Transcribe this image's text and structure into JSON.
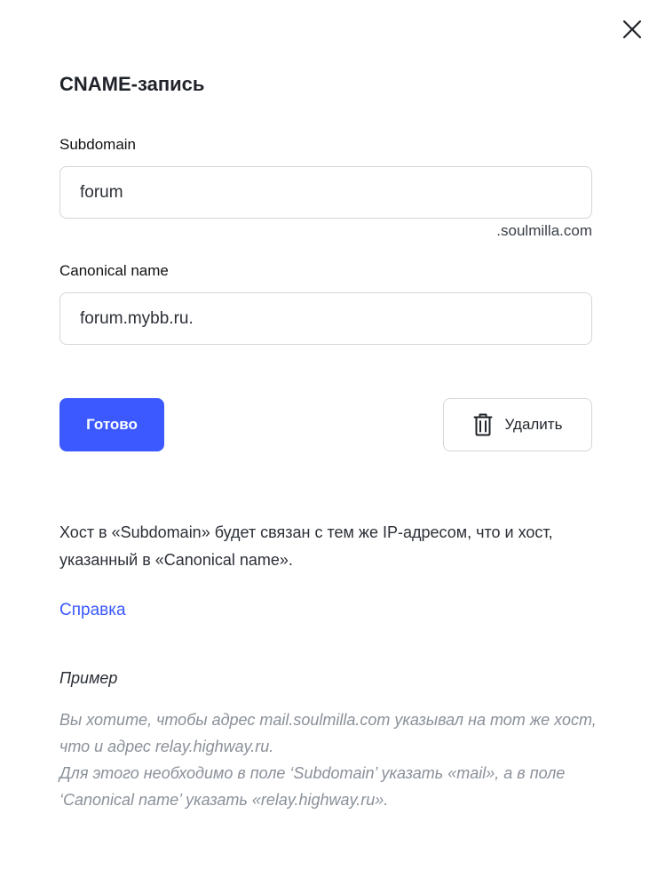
{
  "dialog": {
    "title": "CNAME-запись",
    "close_icon": "close-icon"
  },
  "form": {
    "subdomain": {
      "label": "Subdomain",
      "value": "forum",
      "suffix": ".soulmilla.com"
    },
    "canonical": {
      "label": "Canonical name",
      "value": "forum.mybb.ru."
    }
  },
  "actions": {
    "done_label": "Готово",
    "delete_label": "Удалить",
    "delete_icon": "trash-icon"
  },
  "info": {
    "description": "Хост в «Subdomain» будет связан с тем же IP-адресом, что и хост, указанный в «Canonical name».",
    "help_link": "Справка"
  },
  "example": {
    "title": "Пример",
    "line1": "Вы хотите, чтобы адрес mail.soulmilla.com указывал на тот же хост, что и адрес relay.highway.ru.",
    "line2": "Для этого необходимо в поле ‘Subdomain’ указать «mail», а в поле ‘Canonical name’ указать «relay.highway.ru»."
  },
  "colors": {
    "accent": "#3b59ff",
    "muted_text": "#8a9099",
    "border": "#d3d6db"
  }
}
